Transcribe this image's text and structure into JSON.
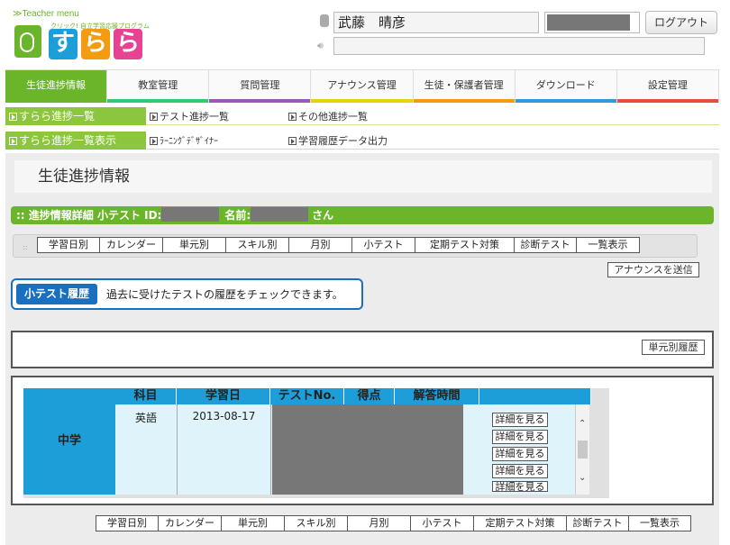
{
  "header": {
    "teacher_menu": "≫Teacher menu",
    "logo_tagline": "クリック! 自立学習応援プログラム",
    "logo_chars": [
      "す",
      "ら",
      "ら"
    ],
    "user_name": "武藤　晴彦",
    "logout_label": "ログアウト"
  },
  "main_nav": [
    {
      "label": "生徒進捗情報",
      "color": "#6bb52a",
      "active": true
    },
    {
      "label": "教室管理",
      "color": "#2ecc71",
      "active": false
    },
    {
      "label": "質問管理",
      "color": "#9b59b6",
      "active": false
    },
    {
      "label": "アナウンス管理",
      "color": "#e5d400",
      "active": false
    },
    {
      "label": "生徒・保護者管理",
      "color": "#f39c12",
      "active": false
    },
    {
      "label": "ダウンロード",
      "color": "#3498db",
      "active": false
    },
    {
      "label": "設定管理",
      "color": "#e74c3c",
      "active": false
    }
  ],
  "sub_nav_1": {
    "active": "すらら進捗一覧",
    "links": [
      "テスト進捗一覧",
      "その他進捗一覧"
    ]
  },
  "sub_nav_2": {
    "active": "すらら進捗一覧表示",
    "links": [
      "ﾗｰﾆﾝｸﾞﾃﾞｻﾞｲﾅｰ",
      "学習履歴データ出力"
    ]
  },
  "page_title": "生徒進捗情報",
  "detail_bar": {
    "prefix": ":: 進捗情報詳細 小テスト ID:",
    "name_label": "名前:",
    "suffix": "さん"
  },
  "tabs": [
    "学習日別",
    "カレンダー",
    "単元別",
    "スキル別",
    "月別",
    "小テスト",
    "定期テスト対策",
    "診断テスト",
    "一覧表示"
  ],
  "send_announce": "アナウンスを送信",
  "info": {
    "label": "小テスト履歴",
    "text": "過去に受けたテストの履歴をチェックできます。"
  },
  "unit_history": "単元別履歴",
  "table": {
    "grade": "中学",
    "headers": [
      "科目",
      "学習日",
      "テストNo.",
      "得点",
      "解答時間"
    ],
    "subject": "英語",
    "date": "2013-08-17",
    "detail_label": "詳細を見る"
  }
}
